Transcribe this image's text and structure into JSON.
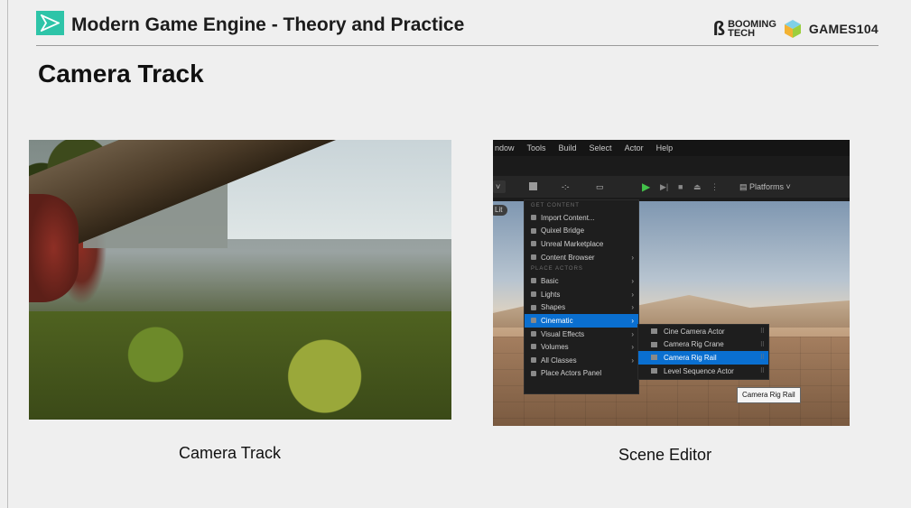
{
  "header": {
    "course_title": "Modern Game Engine - Theory and Practice",
    "brand_booming": "BOOMING",
    "brand_tech": "TECH",
    "brand_games": "GAMES104"
  },
  "slide": {
    "title": "Camera Track",
    "left_caption": "Camera Track",
    "right_caption": "Scene Editor"
  },
  "editor": {
    "menu": [
      "ndow",
      "Tools",
      "Build",
      "Select",
      "Actor",
      "Help"
    ],
    "platforms_label": "Platforms",
    "lit_label": "Lit",
    "get_content_section": "GET CONTENT",
    "get_content_items": [
      "Import Content...",
      "Quixel Bridge",
      "Unreal Marketplace",
      "Content Browser"
    ],
    "place_actors_section": "PLACE ACTORS",
    "place_actors_items": [
      "Basic",
      "Lights",
      "Shapes",
      "Cinematic",
      "Visual Effects",
      "Volumes",
      "All Classes",
      "Place Actors Panel"
    ],
    "cinematic_items": [
      "Cine Camera Actor",
      "Camera Rig Crane",
      "Camera Rig Rail",
      "Level Sequence Actor"
    ],
    "tooltip": "Camera Rig Rail"
  }
}
